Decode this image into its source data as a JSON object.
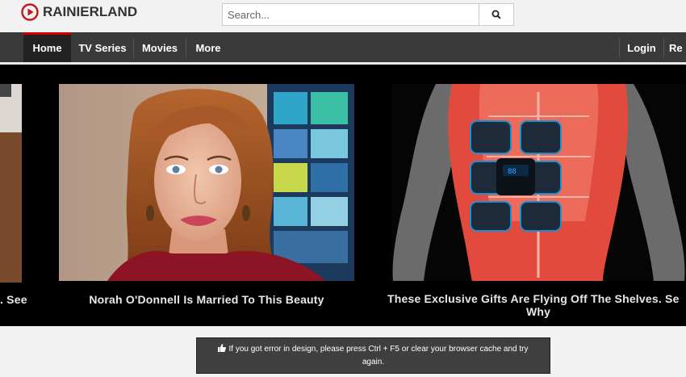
{
  "brand": {
    "name": "RAINIERLAND",
    "accent": "#c4161c"
  },
  "search": {
    "placeholder": "Search...",
    "icon": "search-icon"
  },
  "nav": {
    "items": [
      {
        "label": "Home",
        "active": true
      },
      {
        "label": "TV Series",
        "active": false
      },
      {
        "label": "Movies",
        "active": false
      },
      {
        "label": "More",
        "active": false
      }
    ],
    "right": [
      {
        "label": "Login"
      },
      {
        "label": "Re"
      }
    ]
  },
  "slides": [
    {
      "caption": ". See"
    },
    {
      "caption": "Norah O'Donnell Is Married To This Beauty"
    },
    {
      "caption_line1": "These Exclusive Gifts Are Flying Off The Shelves. Se",
      "caption_line2": "Why"
    }
  ],
  "notice": {
    "icon": "thumbs-up-icon",
    "line1": "If you got error in design, please press Ctrl + F5 or clear your browser cache and try",
    "line2": "again."
  }
}
